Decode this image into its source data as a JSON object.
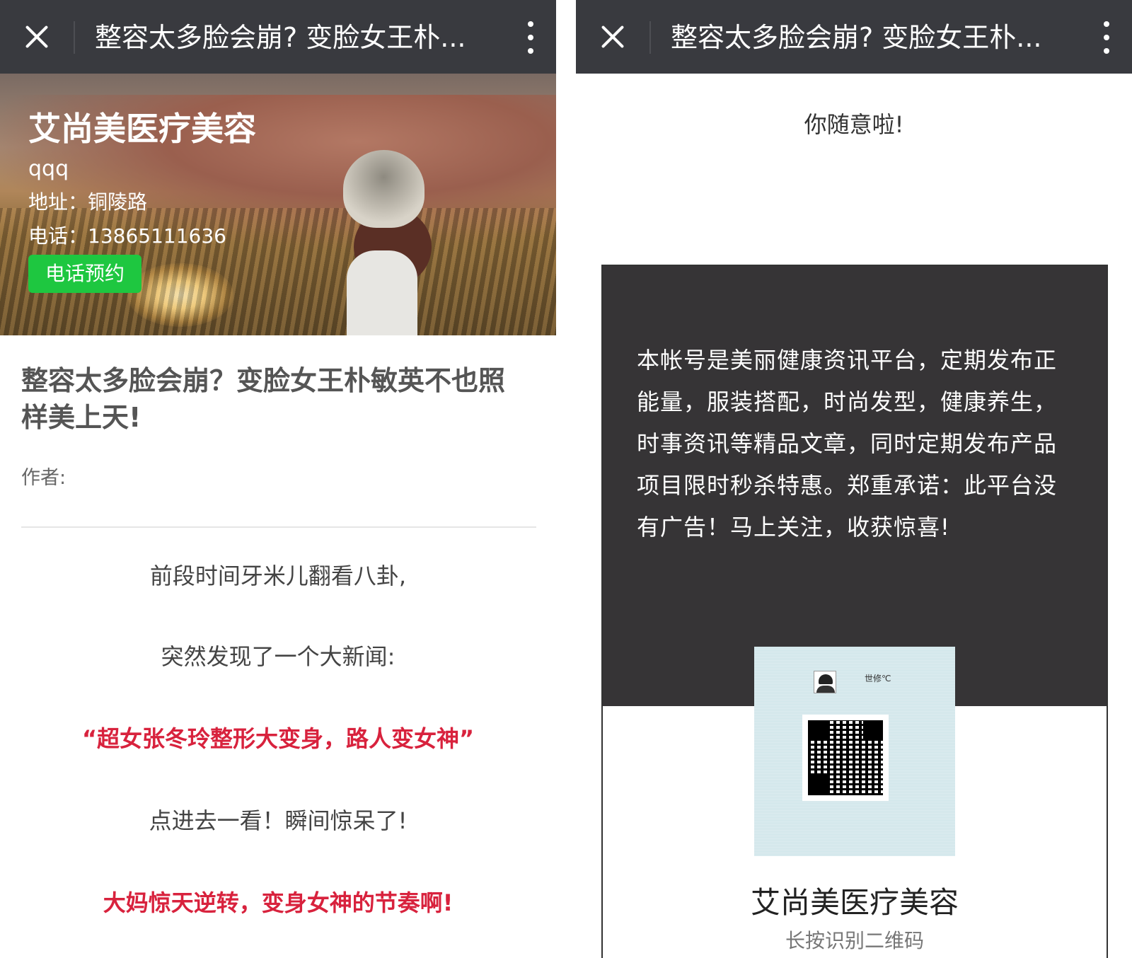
{
  "left": {
    "topbar": {
      "title": "整容太多脸会崩? 变脸女王朴..."
    },
    "banner": {
      "shop_name": "艾尚美医疗美容",
      "subtitle": "qqq",
      "address": "地址：铜陵路",
      "phone": "电话：13865111636",
      "call_button": "电话预约"
    },
    "article": {
      "title": "整容太多脸会崩？变脸女王朴敏英不也照样美上天!",
      "author": "作者:",
      "paragraphs": [
        "前段时间牙米儿翻看八卦,",
        "突然发现了一个大新闻:",
        "“超女张冬玲整形大变身，路人变女神”",
        "点进去一看！瞬间惊呆了!",
        "大妈惊天逆转，变身女神的节奏啊!"
      ]
    }
  },
  "right": {
    "topbar": {
      "title": "整容太多脸会崩? 变脸女王朴..."
    },
    "thanks": "你随意啦!",
    "card": {
      "description": "本帐号是美丽健康资讯平台，定期发布正能量，服装搭配，时尚发型，健康养生，时事资讯等精品文章，同时定期发布产品项目限时秒杀特惠。郑重承诺：此平台没有广告！马上关注，收获惊喜!",
      "qr_owner": "世修℃",
      "shop_name": "艾尚美医疗美容",
      "hint": "长按识别二维码"
    }
  },
  "colors": {
    "topbar": "#393a3f",
    "accent_green": "#1ec740",
    "highlight_red": "#d8223d",
    "card_dark": "#363436"
  }
}
